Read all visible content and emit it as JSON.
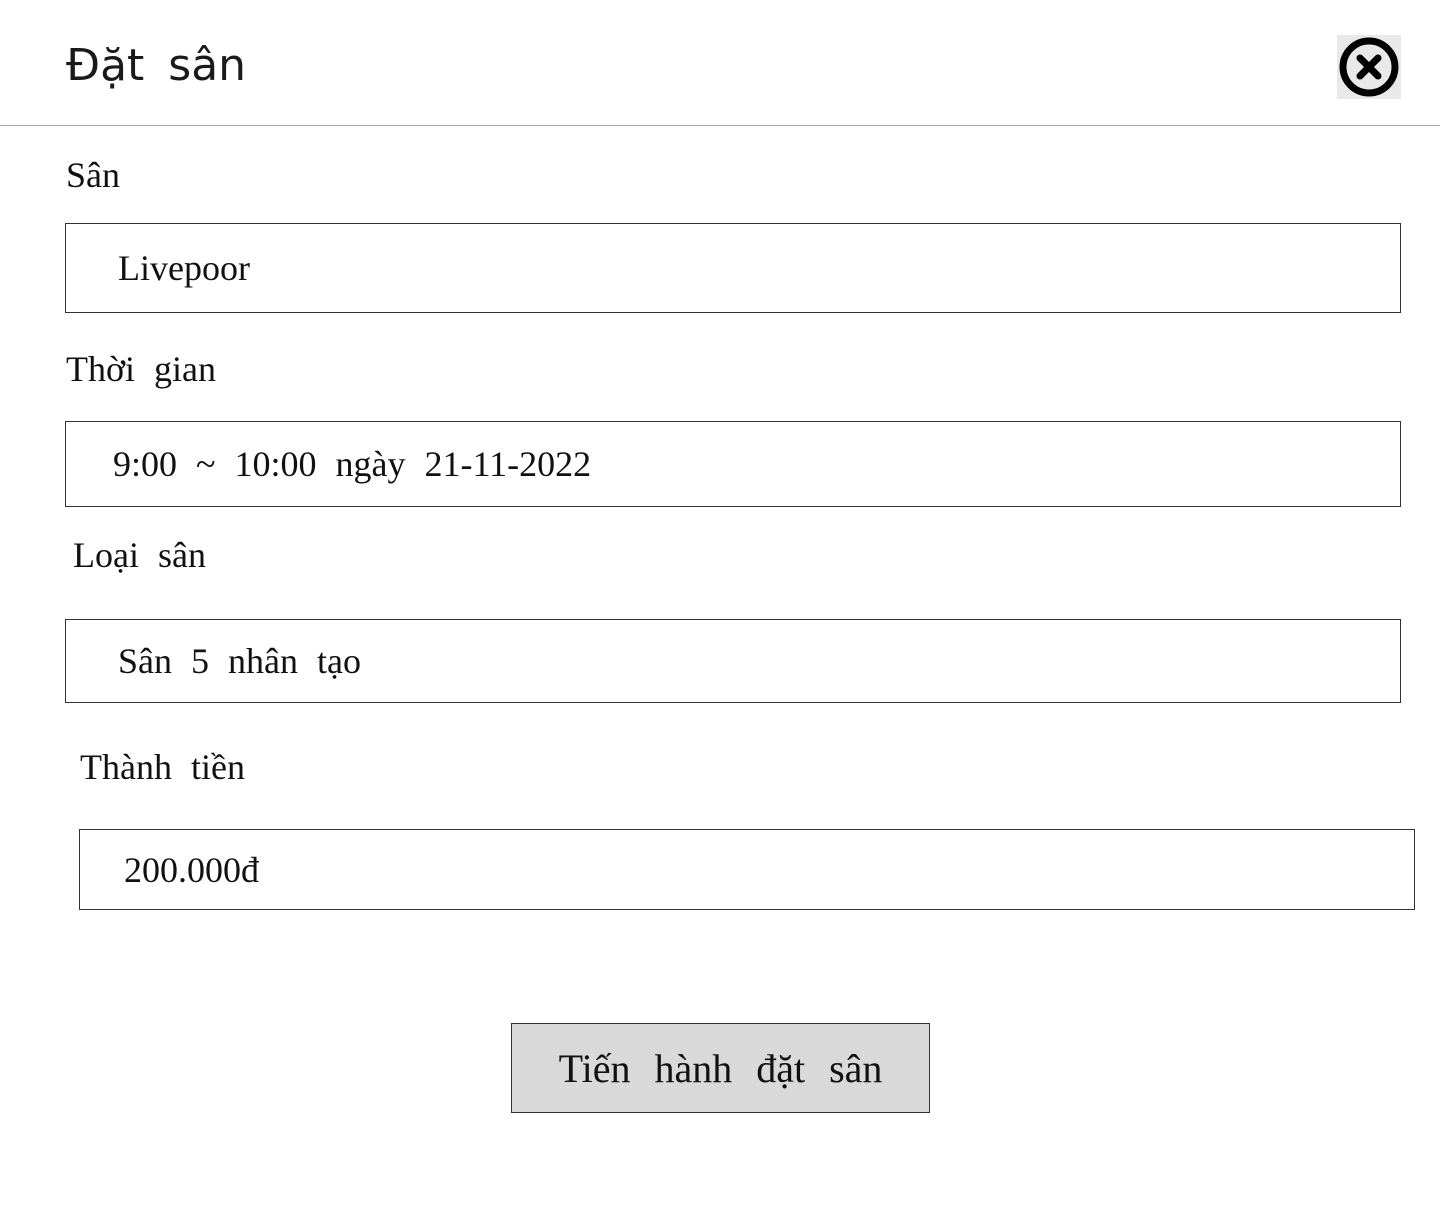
{
  "header": {
    "title": "Đặt sân",
    "close_icon": "close-circle-x-icon"
  },
  "form": {
    "san": {
      "label": "Sân",
      "value": "Livepoor"
    },
    "thoi_gian": {
      "label": "Thời gian",
      "value": "9:00 ~ 10:00 ngày 21-11-2022"
    },
    "loai_san": {
      "label": "Loại sân",
      "value": "Sân 5 nhân tạo"
    },
    "thanh_tien": {
      "label": "Thành tiền",
      "value": "200.000đ"
    }
  },
  "actions": {
    "submit_label": "Tiến hành đặt sân"
  }
}
